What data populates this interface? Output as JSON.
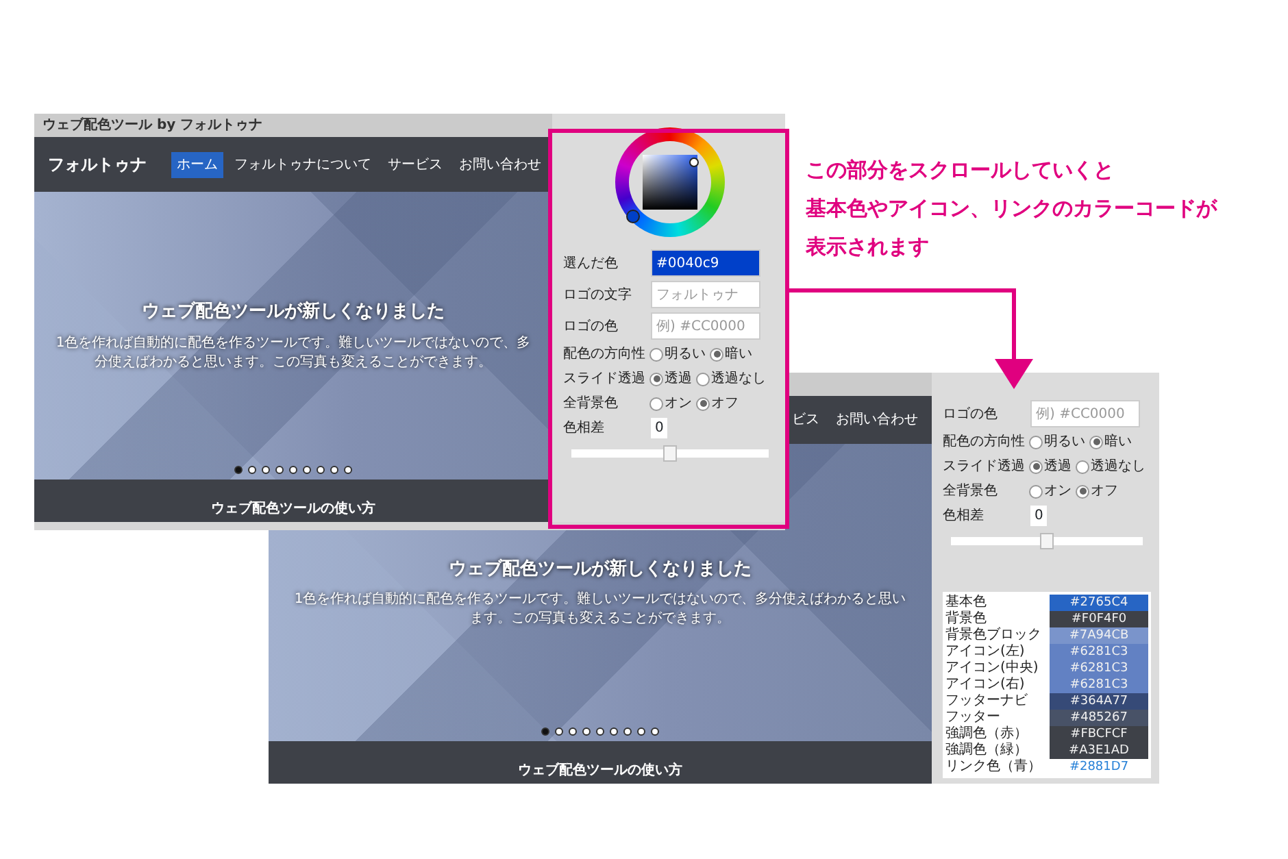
{
  "annotation": {
    "lines": [
      "この部分をスクロールしていくと",
      "基本色やアイコン、リンクのカラーコードが",
      "表示されます"
    ]
  },
  "front_window": {
    "title": "ウェブ配色ツール by フォルトゥナ",
    "brand": "フォルトゥナ",
    "nav": [
      {
        "label": "ホーム",
        "selected": true
      },
      {
        "label": "フォルトゥナについて",
        "selected": false
      },
      {
        "label": "サービス",
        "selected": false
      },
      {
        "label": "お問い合わせ",
        "selected": false
      }
    ],
    "hero": {
      "heading": "ウェブ配色ツールが新しくなりました",
      "text": "1色を作れば自動的に配色を作るツールです。難しいツールではないので、多分使えばわかると思います。この写真も変えることができます。",
      "dots": [
        {
          "selected": true
        },
        {
          "selected": false
        },
        {
          "selected": false
        },
        {
          "selected": false
        },
        {
          "selected": false
        },
        {
          "selected": false
        },
        {
          "selected": false
        },
        {
          "selected": false
        },
        {
          "selected": false
        }
      ]
    },
    "footer_heading": "ウェブ配色ツールの使い方",
    "panel": {
      "fields": [
        {
          "label": "選んだ色",
          "value": "#0040c9"
        },
        {
          "label": "ロゴの文字",
          "placeholder": "フォルトゥナ"
        },
        {
          "label": "ロゴの色",
          "placeholder": "例) #CC0000"
        }
      ],
      "options": [
        {
          "label": "配色の方向性",
          "choices": [
            {
              "label": "明るい",
              "selected": false
            },
            {
              "label": "暗い",
              "selected": true
            }
          ]
        },
        {
          "label": "スライド透過",
          "choices": [
            {
              "label": "透過",
              "selected": true
            },
            {
              "label": "透過なし",
              "selected": false
            }
          ]
        },
        {
          "label": "全背景色",
          "choices": [
            {
              "label": "オン",
              "selected": false
            },
            {
              "label": "オフ",
              "selected": true
            }
          ]
        }
      ],
      "hue": {
        "label": "色相差",
        "value": "0",
        "level": 0.5
      }
    }
  },
  "back_window": {
    "nav": [
      {
        "label": "ビス"
      },
      {
        "label": "お問い合わせ"
      }
    ],
    "hero": {
      "heading": "ウェブ配色ツールが新しくなりました",
      "text": "1色を作れば自動的に配色を作るツールです。難しいツールではないので、多分使えばわかると思います。この写真も変えることができます。",
      "dots": [
        {
          "selected": true
        },
        {
          "selected": false
        },
        {
          "selected": false
        },
        {
          "selected": false
        },
        {
          "selected": false
        },
        {
          "selected": false
        },
        {
          "selected": false
        },
        {
          "selected": false
        },
        {
          "selected": false
        }
      ]
    },
    "footer_heading": "ウェブ配色ツールの使い方",
    "panel": {
      "fields": [
        {
          "label": "ロゴの色",
          "placeholder": "例) #CC0000"
        }
      ],
      "options": [
        {
          "label": "配色の方向性",
          "choices": [
            {
              "label": "明るい",
              "selected": false
            },
            {
              "label": "暗い",
              "selected": true
            }
          ]
        },
        {
          "label": "スライド透過",
          "choices": [
            {
              "label": "透過",
              "selected": true
            },
            {
              "label": "透過なし",
              "selected": false
            }
          ]
        },
        {
          "label": "全背景色",
          "choices": [
            {
              "label": "オン",
              "selected": false
            },
            {
              "label": "オフ",
              "selected": true
            }
          ]
        }
      ],
      "hue": {
        "label": "色相差",
        "value": "0",
        "level": 0.5
      },
      "colors": [
        {
          "label": "基本色",
          "value": "#2765C4",
          "color": "#2765c4"
        },
        {
          "label": "背景色",
          "value": "#F0F4F0",
          "color": "#3e4148"
        },
        {
          "label": "背景色ブロック",
          "value": "#7A94CB",
          "color": "#7a94cb"
        },
        {
          "label": "アイコン(左)",
          "value": "#6281C3",
          "color": "#6281c3"
        },
        {
          "label": "アイコン(中央)",
          "value": "#6281C3",
          "color": "#6281c3"
        },
        {
          "label": "アイコン(右)",
          "value": "#6281C3",
          "color": "#6281c3"
        },
        {
          "label": "フッターナビ",
          "value": "#364A77",
          "color": "#364a77"
        },
        {
          "label": "フッター",
          "value": "#485267",
          "color": "#485267"
        },
        {
          "label": "強調色（赤）",
          "value": "#FBCFCF",
          "color": "#3e4148"
        },
        {
          "label": "強調色（緑）",
          "value": "#A3E1AD",
          "color": "#3e4148"
        },
        {
          "label": "リンク色（青）",
          "value": "#2881D7",
          "color": "#ffffff"
        }
      ]
    }
  }
}
